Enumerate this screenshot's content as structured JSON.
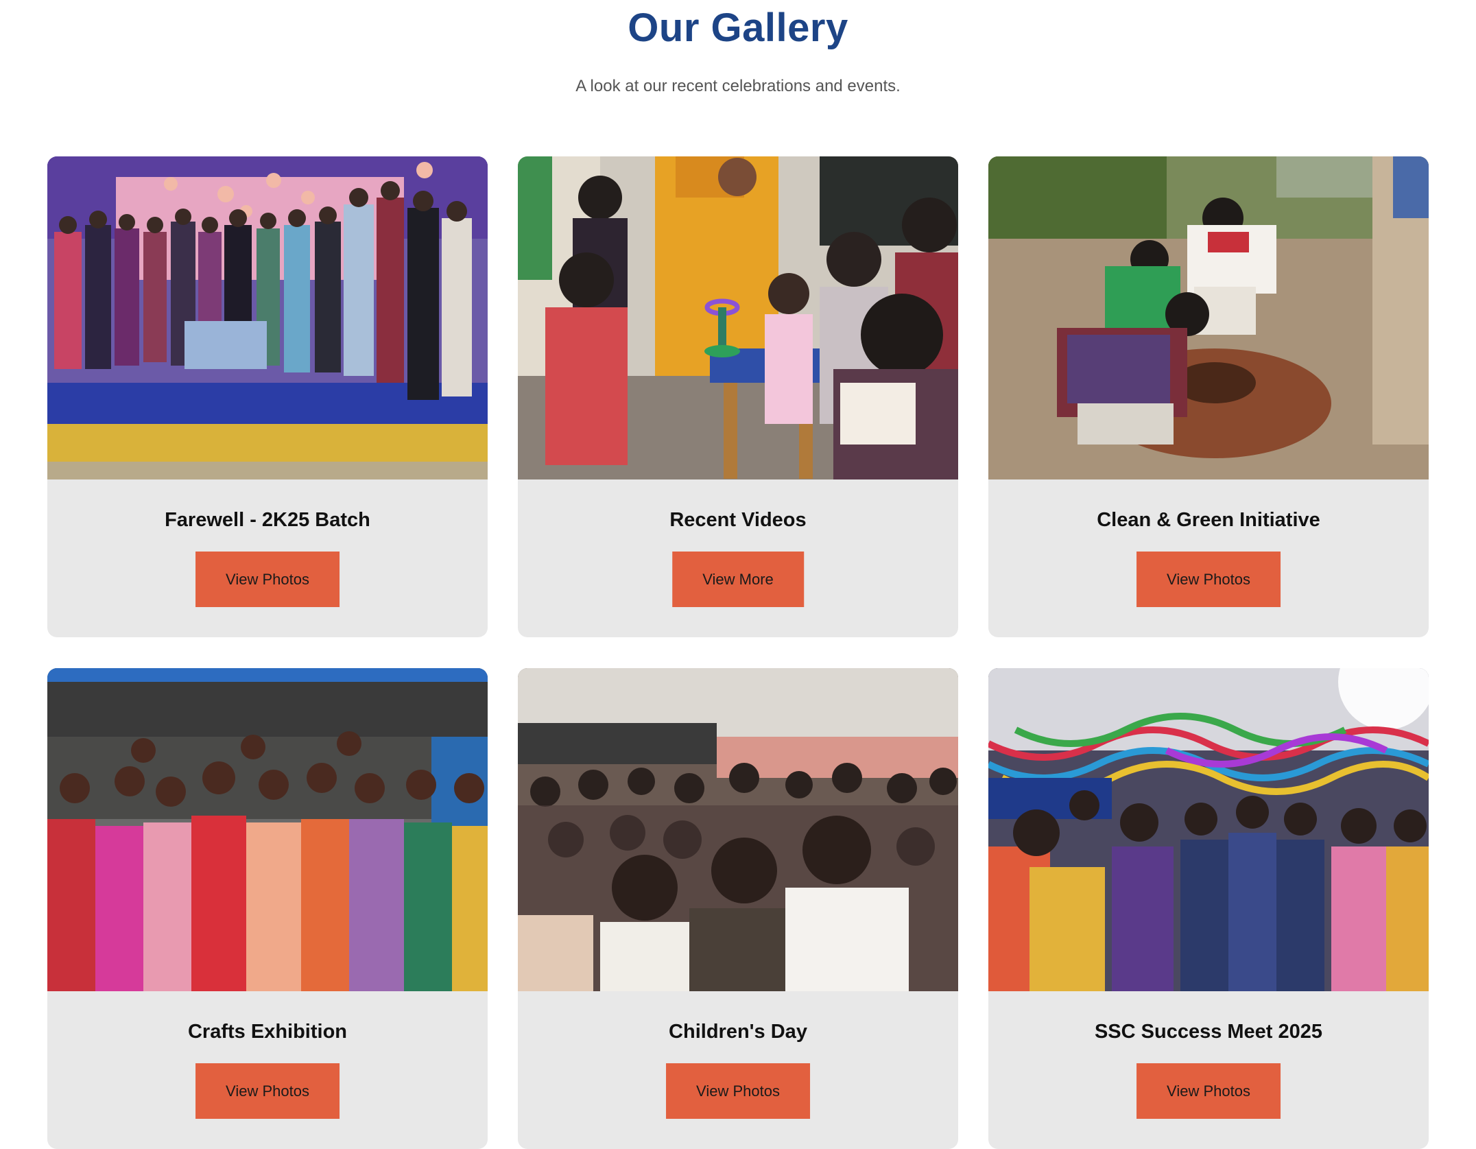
{
  "gallery": {
    "title": "Our Gallery",
    "subtitle": "A look at our recent celebrations and events.",
    "accent_color": "#1d4486",
    "button_color": "#e2603f",
    "cards": [
      {
        "title": "Farewell - 2K25 Batch",
        "button": "View Photos"
      },
      {
        "title": "Recent Videos",
        "button": "View More"
      },
      {
        "title": "Clean & Green Initiative",
        "button": "View Photos"
      },
      {
        "title": "Crafts Exhibition",
        "button": "View Photos"
      },
      {
        "title": "Children's Day",
        "button": "View Photos"
      },
      {
        "title": "SSC Success Meet 2025",
        "button": "View Photos"
      }
    ]
  }
}
